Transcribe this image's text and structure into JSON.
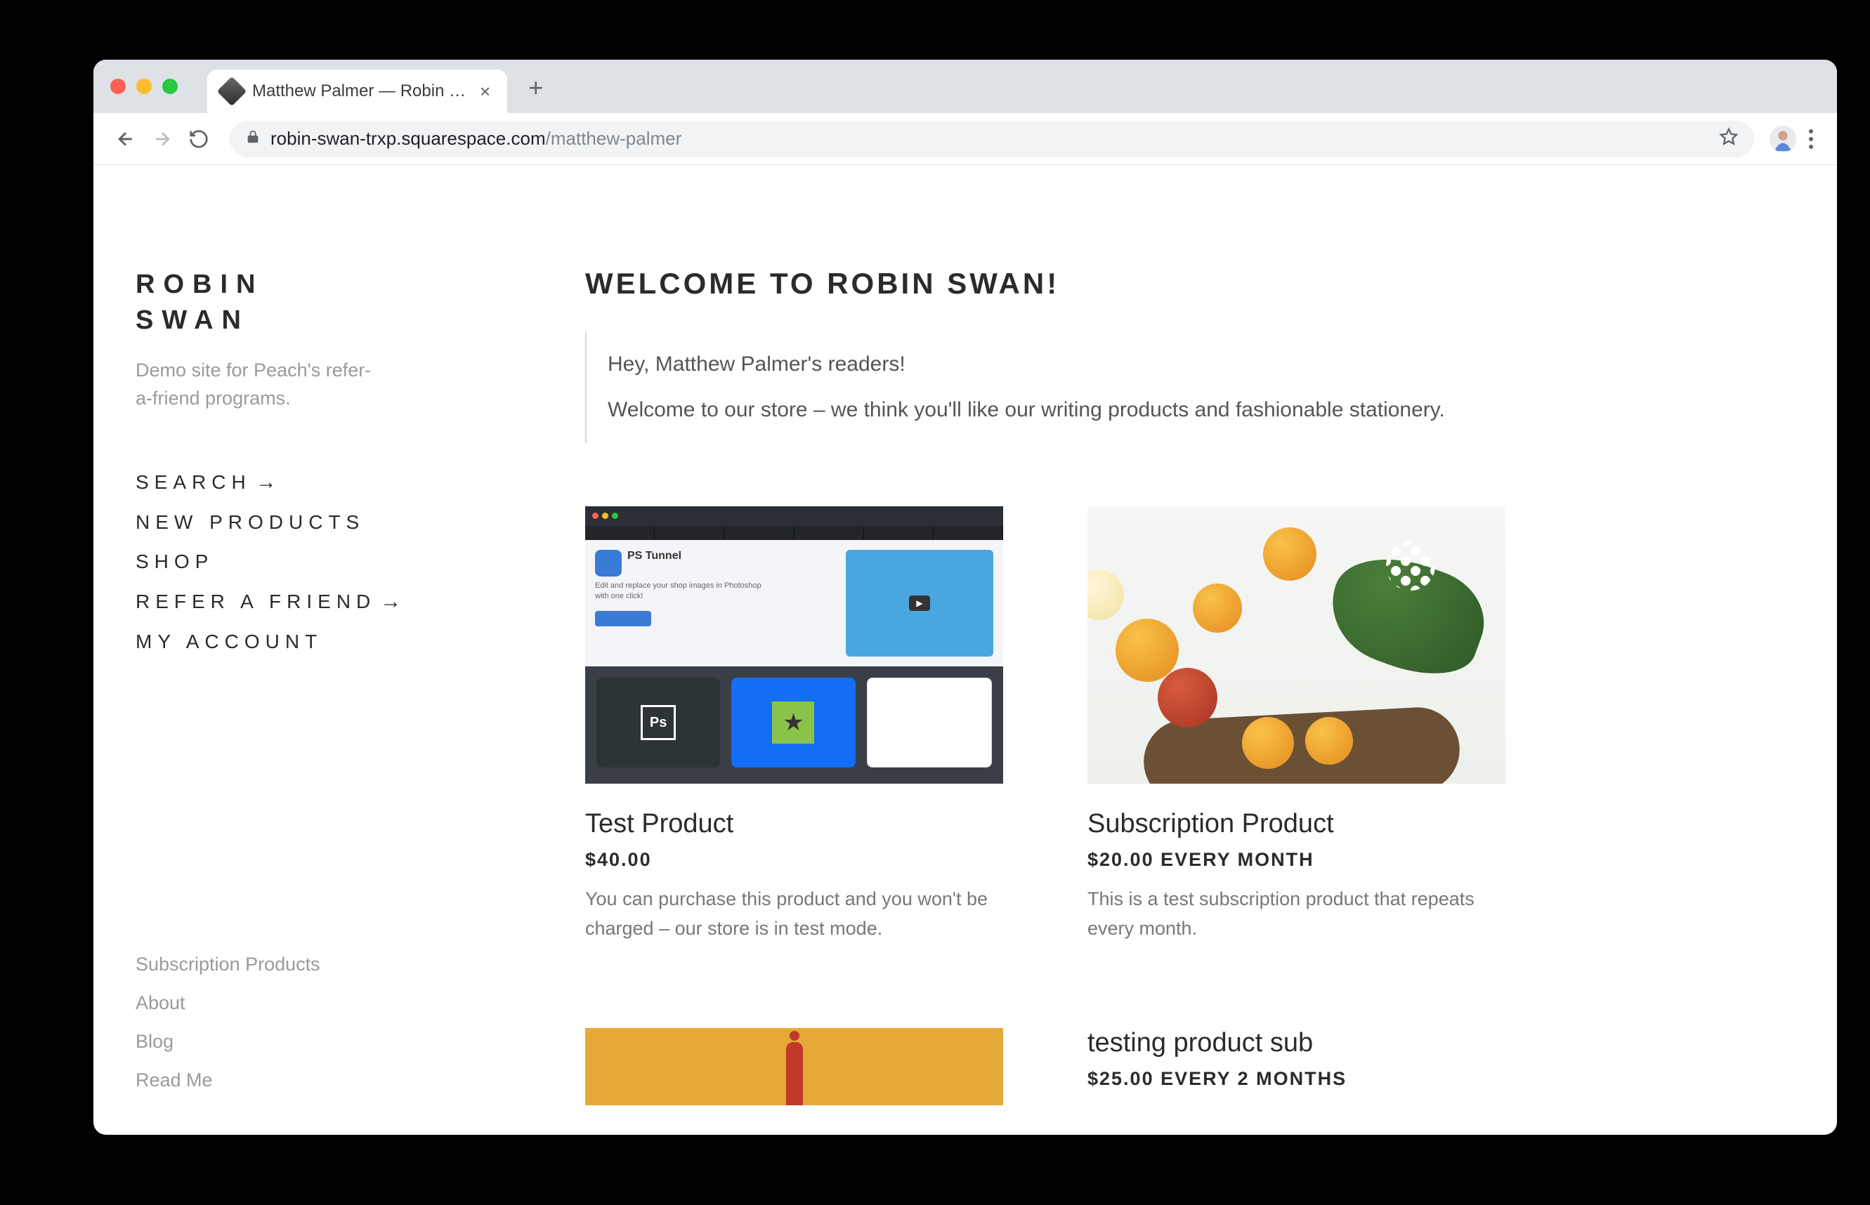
{
  "browser": {
    "tab_title": "Matthew Palmer — Robin Swan",
    "url_host": "robin-swan-trxp.squarespace.com",
    "url_path": "/matthew-palmer"
  },
  "sidebar": {
    "site_title_line1": "ROBIN",
    "site_title_line2": "SWAN",
    "tagline": "Demo site for Peach's refer-a-friend programs.",
    "nav": [
      {
        "label": "SEARCH",
        "arrow": true
      },
      {
        "label": "NEW PRODUCTS",
        "arrow": false
      },
      {
        "label": "SHOP",
        "arrow": false
      },
      {
        "label": "REFER A FRIEND",
        "arrow": true
      },
      {
        "label": "MY ACCOUNT",
        "arrow": false
      }
    ],
    "secondary_nav": [
      {
        "label": "Subscription Products"
      },
      {
        "label": "About"
      },
      {
        "label": "Blog"
      },
      {
        "label": "Read Me"
      }
    ]
  },
  "main": {
    "heading": "WELCOME TO ROBIN SWAN!",
    "intro_line1": "Hey, Matthew Palmer's readers!",
    "intro_line2": "Welcome to our store – we think you'll like our writing products and fashionable stationery.",
    "products": [
      {
        "title": "Test Product",
        "price": "$40.00",
        "desc": "You can purchase this product and you won't be charged – our store is in test mode."
      },
      {
        "title": "Subscription Product",
        "price": "$20.00 every month",
        "desc": "This is a test subscription product that repeats every month."
      },
      {
        "title": "",
        "price": "",
        "desc": ""
      },
      {
        "title": "testing product sub",
        "price": "$25.00 every 2 months",
        "desc": ""
      }
    ]
  }
}
